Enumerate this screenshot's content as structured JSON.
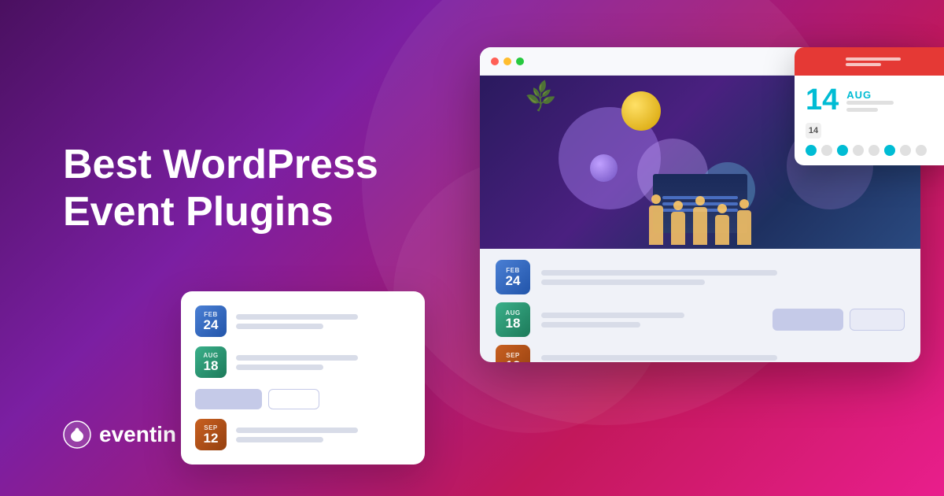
{
  "background": {
    "gradient_start": "#4a1060",
    "gradient_end": "#e91e8c"
  },
  "title": {
    "line1": "Best WordPress",
    "line2": "Event Plugins"
  },
  "logo": {
    "name": "eventin",
    "icon_unicode": "♥"
  },
  "browser": {
    "dots": [
      "red",
      "yellow",
      "green"
    ]
  },
  "events": [
    {
      "month": "FEB",
      "day": "24",
      "badge_class": "date-badge-blue"
    },
    {
      "month": "AUG",
      "day": "18",
      "badge_class": "date-badge-green"
    },
    {
      "month": "SEP",
      "day": "12",
      "badge_class": "date-badge-orange"
    }
  ],
  "calendar": {
    "header_color": "#e53935",
    "day": "14",
    "month": "AUG",
    "small_number": "14"
  },
  "icons": {
    "location_pin": "📍"
  }
}
